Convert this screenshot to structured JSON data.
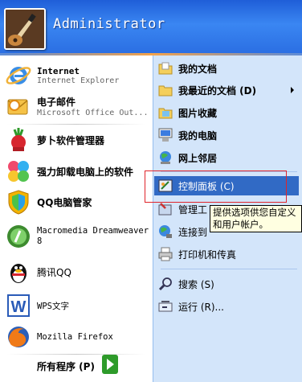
{
  "header": {
    "username": "Administrator"
  },
  "left": {
    "pinned": [
      {
        "title": "Internet",
        "subtitle": "Internet Explorer",
        "icon": "ie-icon"
      },
      {
        "title": "电子邮件",
        "subtitle": "Microsoft Office Out...",
        "icon": "outlook-icon"
      }
    ],
    "recent": [
      {
        "label": "萝卜软件管理器",
        "icon": "radish-icon"
      },
      {
        "label": "强力卸载电脑上的软件",
        "icon": "pinwheel-icon"
      },
      {
        "label": "QQ电脑管家",
        "icon": "shield-icon"
      },
      {
        "label": "Macromedia Dreamweaver 8",
        "icon": "dreamweaver-icon"
      },
      {
        "label": "腾讯QQ",
        "icon": "penguin-icon"
      },
      {
        "label": "WPS文字",
        "icon": "wps-icon"
      },
      {
        "label": "Mozilla Firefox",
        "icon": "firefox-icon"
      }
    ],
    "all_programs": "所有程序 (P)"
  },
  "right": {
    "items": [
      {
        "label": "我的文档",
        "icon": "documents-folder-icon"
      },
      {
        "label": "我最近的文档 (D)",
        "icon": "recent-folder-icon",
        "submenu": true
      },
      {
        "label": "图片收藏",
        "icon": "pictures-folder-icon"
      },
      {
        "label": "我的电脑",
        "icon": "computer-icon"
      },
      {
        "label": "网上邻居",
        "icon": "network-icon"
      },
      {
        "label": "控制面板 (C)",
        "icon": "control-panel-icon",
        "selected": true
      },
      {
        "label": "管理工",
        "icon": "admin-tools-icon"
      },
      {
        "label": "连接到",
        "icon": "connect-icon"
      },
      {
        "label": "打印机和传真",
        "icon": "printer-icon"
      },
      {
        "label": "搜索 (S)",
        "icon": "search-icon"
      },
      {
        "label": "运行 (R)...",
        "icon": "run-icon"
      }
    ]
  },
  "tooltip": {
    "line1": "提供选项供您自定义",
    "line2": "和用户帐户。"
  }
}
